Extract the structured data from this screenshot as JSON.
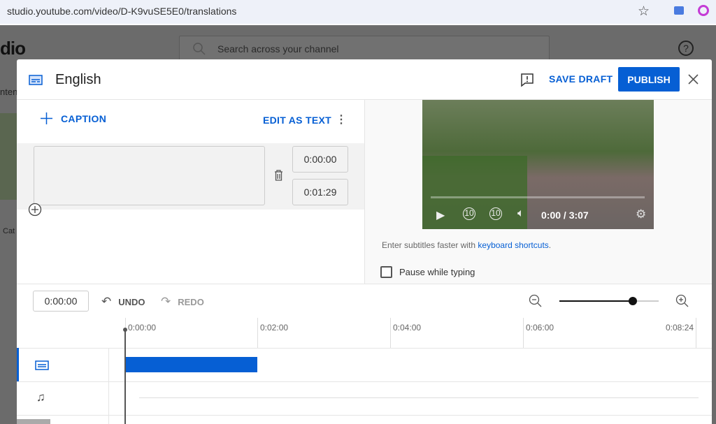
{
  "browser": {
    "url": "studio.youtube.com/video/D-K9vuSE5E0/translations"
  },
  "background": {
    "logo_text": "dio",
    "search_placeholder": "Search across your channel",
    "side_text": "nten",
    "side_text2": "Cat"
  },
  "dialog": {
    "title": "English",
    "save_draft": "SAVE DRAFT",
    "publish": "PUBLISH",
    "accent": "#065fd4",
    "caption_button": "CAPTION",
    "edit_as_text": "EDIT AS TEXT",
    "caption": {
      "text": "",
      "start": "0:00:00",
      "end": "0:01:29"
    },
    "video": {
      "time": "0:00 / 3:07"
    },
    "hint_prefix": "Enter subtitles faster with ",
    "hint_link": "keyboard shortcuts",
    "hint_suffix": ".",
    "pause_label": "Pause while typing",
    "pause_checked": false
  },
  "timeline": {
    "current_time": "0:00:00",
    "undo": "UNDO",
    "redo": "REDO",
    "zoom_level": 0.74,
    "ticks": [
      "0:00:00",
      "0:02:00",
      "0:04:00",
      "0:06:00",
      "0:08:24"
    ]
  }
}
